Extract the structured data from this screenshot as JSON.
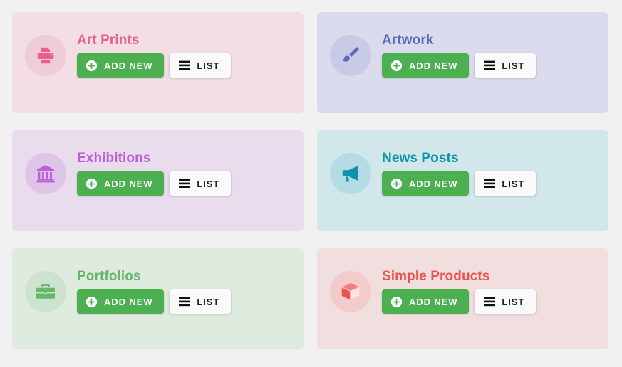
{
  "page": {
    "background": "#f1f1f1",
    "layout": "2-column card grid, 3 rows",
    "accent_green": "#4caf50"
  },
  "buttons": {
    "add_new_label": "ADD NEW",
    "list_label": "LIST",
    "add_new_icon": "plus-circle-icon",
    "list_icon": "list-lines-icon",
    "add_new_bg": "#4caf50",
    "add_new_text_color": "#ffffff",
    "list_bg": "#fafafa",
    "list_text_color": "#202020"
  },
  "cards": [
    {
      "id": "art-prints",
      "title": "Art Prints",
      "icon": "printer-icon",
      "card_bg": "#f2dee4",
      "circle_bg": "#eeccd8",
      "accent": "#e8608c",
      "title_color": "#e8608c"
    },
    {
      "id": "artwork",
      "title": "Artwork",
      "icon": "paintbrush-icon",
      "card_bg": "#dadced",
      "circle_bg": "#c7cbe6",
      "accent": "#5b68c0",
      "title_color": "#5b68c0"
    },
    {
      "id": "exhibitions",
      "title": "Exhibitions",
      "icon": "museum-building-icon",
      "card_bg": "#e8dced",
      "circle_bg": "#ddc4e8",
      "accent": "#bb5fd2",
      "title_color": "#bb5fd2"
    },
    {
      "id": "news-posts",
      "title": "News Posts",
      "icon": "megaphone-icon",
      "card_bg": "#d2e7ea",
      "circle_bg": "#b5dce4",
      "accent": "#0f92ad",
      "title_color": "#0f92ad"
    },
    {
      "id": "portfolios",
      "title": "Portfolios",
      "icon": "briefcase-icon",
      "card_bg": "#e0ebe0",
      "circle_bg": "#cde3cf",
      "accent": "#66b869",
      "title_color": "#66b869"
    },
    {
      "id": "simple-products",
      "title": "Simple Products",
      "icon": "box-cube-icon",
      "card_bg": "#f1dedf",
      "circle_bg": "#f2cbcb",
      "accent": "#ef5350",
      "title_color": "#ef5350"
    }
  ]
}
